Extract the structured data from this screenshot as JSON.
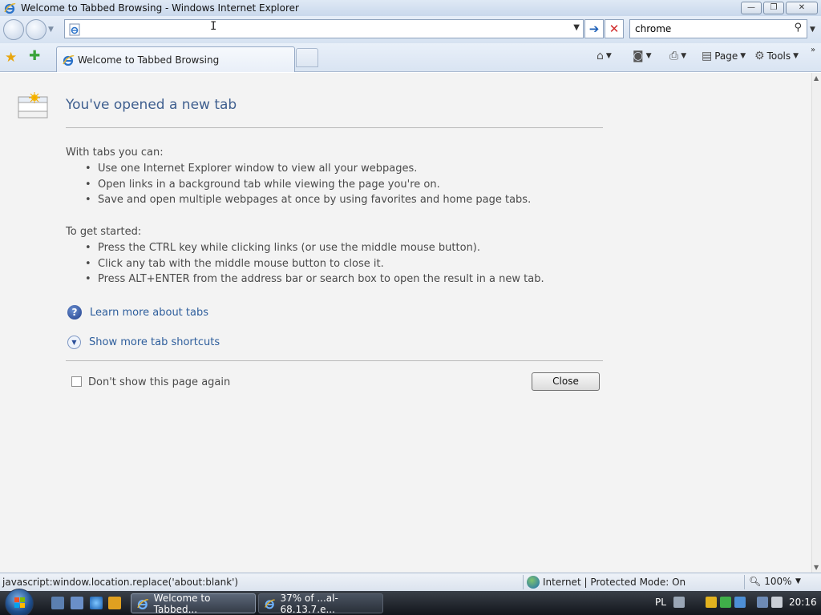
{
  "window": {
    "title": "Welcome to Tabbed Browsing - Windows Internet Explorer",
    "minimize_glyph": "—",
    "restore_glyph": "❐",
    "close_glyph": "✕"
  },
  "address_bar": {
    "value": "",
    "go_glyph": "➔",
    "stop_glyph": "✕"
  },
  "search_box": {
    "value": "chrome",
    "icon": "magnifier-icon"
  },
  "tabs": [
    {
      "label": "Welcome to Tabbed Browsing",
      "active": true
    }
  ],
  "command_bar": {
    "page_label": "Page",
    "tools_label": "Tools",
    "overflow_glyph": "»"
  },
  "content": {
    "heading": "You've opened a new tab",
    "with_tabs_intro": "With tabs you can:",
    "with_tabs_items": [
      "Use one Internet Explorer window to view all your webpages.",
      "Open links in a background tab while viewing the page you're on.",
      "Save and open multiple webpages at once by using favorites and home page tabs."
    ],
    "get_started_intro": "To get started:",
    "get_started_items": [
      "Press the CTRL key while clicking links (or use the middle mouse button).",
      "Click any tab with the middle mouse button to close it.",
      "Press ALT+ENTER from the address bar or search box to open the result in a new tab."
    ],
    "learn_more_link": "Learn more about tabs",
    "shortcuts_link": "Show more tab shortcuts",
    "dont_show_label": "Don't show this page again",
    "dont_show_checked": false,
    "close_button": "Close"
  },
  "status_bar": {
    "text": "javascript:window.location.replace('about:blank')",
    "zone": "Internet | Protected Mode: On",
    "zoom": "100%"
  },
  "taskbar": {
    "items": [
      {
        "label": "Welcome to Tabbed...",
        "active": true
      },
      {
        "label": "37% of ...al-68.13.7.e...",
        "active": false
      }
    ],
    "language": "PL",
    "clock": "20:16"
  },
  "colors": {
    "link": "#2e5e9c",
    "heading": "#3f5f8f",
    "content_bg": "#f3f3f3"
  }
}
